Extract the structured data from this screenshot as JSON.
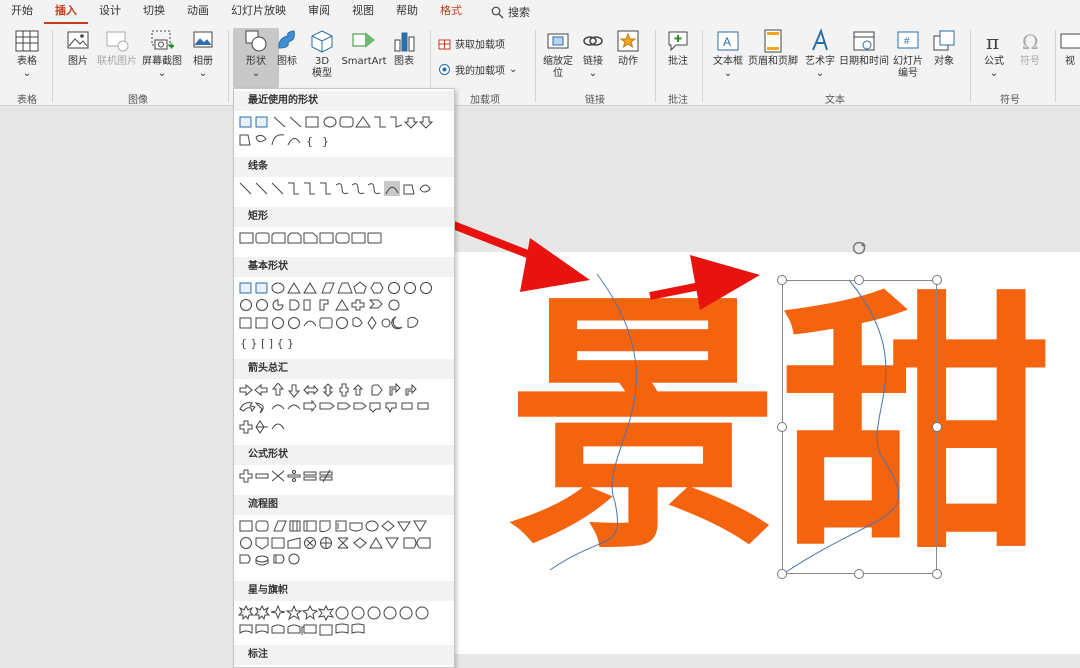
{
  "tabs": [
    "开始",
    "插入",
    "设计",
    "切换",
    "动画",
    "幻灯片放映",
    "审阅",
    "视图",
    "帮助",
    "格式"
  ],
  "search_label": "搜索",
  "ribbon": {
    "table": {
      "label": "表格",
      "group": "表格"
    },
    "image": {
      "picture": "图片",
      "online_picture": "联机图片",
      "screenshot": "屏幕截图",
      "album": "相册",
      "group": "图像"
    },
    "illus": {
      "shapes": "形状",
      "icons": "图标",
      "model3d": "3D\n模型",
      "smartart": "SmartArt",
      "chart": "图表"
    },
    "addins": {
      "get": "获取加载项",
      "mine": "我的加载项",
      "group": "加载项"
    },
    "links": {
      "zoom": "缩放定\n位",
      "link": "链接",
      "action": "动作",
      "group": "链接"
    },
    "comments": {
      "comment": "批注",
      "group": "批注"
    },
    "text": {
      "textbox": "文本框",
      "header_footer": "页眉和页脚",
      "wordart": "艺术字",
      "datetime": "日期和时间",
      "slide_number": "幻灯片\n编号",
      "object": "对象",
      "group": "文本"
    },
    "symbols": {
      "equation": "公式",
      "symbol": "符号",
      "group": "符号"
    },
    "more": {
      "video": "视"
    }
  },
  "menu": {
    "recent": "最近使用的形状",
    "lines": "线条",
    "rect": "矩形",
    "basic": "基本形状",
    "arrows": "箭头总汇",
    "equation": "公式形状",
    "flowchart": "流程图",
    "stars": "星与旗帜",
    "callouts": "标注",
    "recent_row2": "{ }",
    "basic_row5": "{ } [ ] { }",
    "rect_count": "9"
  },
  "slide": {
    "char1": "景",
    "char2": "甜"
  },
  "colors": {
    "accent": "#c43e1c",
    "text_orange": "#f4630e",
    "arrow": "#e8120e"
  }
}
